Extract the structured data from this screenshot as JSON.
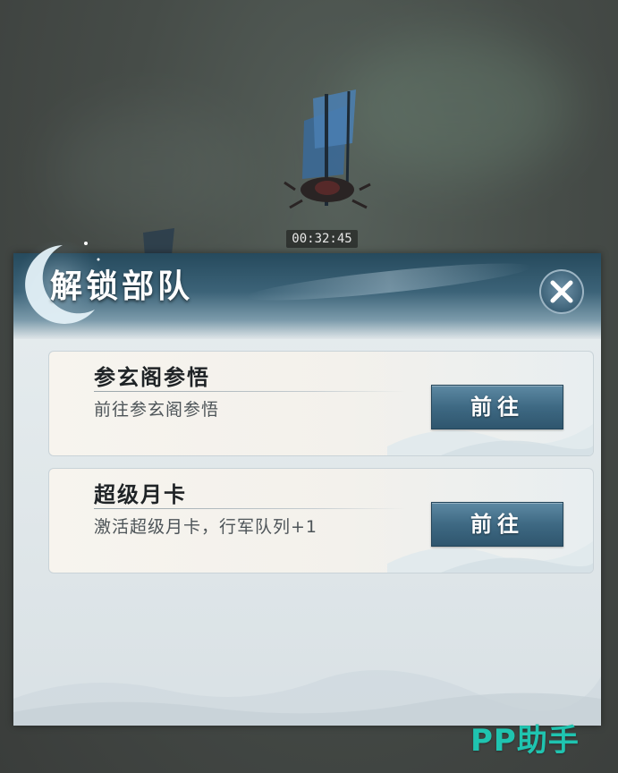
{
  "hud": {
    "timer": "00:32:45"
  },
  "dialog": {
    "title": "解锁部队",
    "close_icon": "close-icon"
  },
  "cards": [
    {
      "title": "参玄阁参悟",
      "description": "前往参玄阁参悟",
      "button_label": "前往"
    },
    {
      "title": "超级月卡",
      "description": "激活超级月卡，行军队列+1",
      "button_label": "前往"
    }
  ],
  "watermark": {
    "text": "PP助手"
  },
  "colors": {
    "header_dark": "#264a5d",
    "button_blue": "#3e6983",
    "watermark_teal": "#1fc4b0"
  }
}
